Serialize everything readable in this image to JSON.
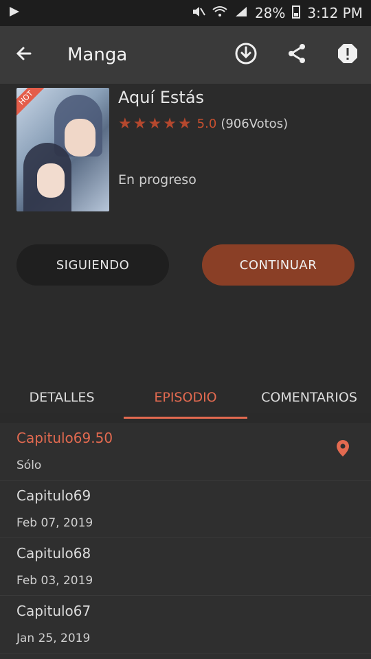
{
  "status": {
    "battery": "28%",
    "time": "3:12 PM"
  },
  "appbar": {
    "title": "Manga"
  },
  "manga": {
    "title": "Aquí Estás",
    "hot_badge": "HOT",
    "rating": "5.0",
    "votes": "(906Votos)",
    "state": "En progreso"
  },
  "buttons": {
    "follow": "SIGUIENDO",
    "continue": "CONTINUAR"
  },
  "tabs": [
    {
      "label": "DETALLES"
    },
    {
      "label": "EPISODIO"
    },
    {
      "label": "COMENTARIOS"
    }
  ],
  "episodes": [
    {
      "title": "Capitulo69.50",
      "sub": "Sólo"
    },
    {
      "title": "Capitulo69",
      "sub": "Feb 07, 2019"
    },
    {
      "title": "Capitulo68",
      "sub": "Feb 03, 2019"
    },
    {
      "title": "Capitulo67",
      "sub": "Jan 25, 2019"
    }
  ],
  "colors": {
    "accent": "#e36a50",
    "button_accent": "#8a3f26",
    "star": "#b5482e"
  },
  "icons": [
    "back-arrow-icon",
    "download-icon",
    "share-icon",
    "report-icon",
    "location-pin-icon",
    "mute-icon",
    "wifi-icon",
    "signal-icon",
    "battery-icon",
    "app-icon"
  ]
}
